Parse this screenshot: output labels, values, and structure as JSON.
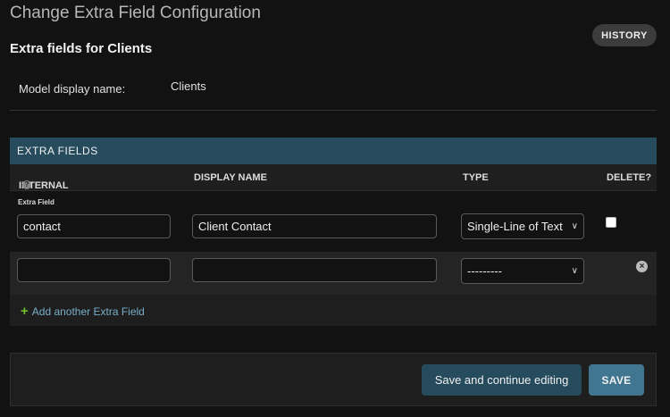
{
  "page": {
    "title": "Change Extra Field Configuration",
    "history_label": "HISTORY",
    "section_title": "Extra fields for Clients"
  },
  "model": {
    "label": "Model display name:",
    "value": "Clients"
  },
  "inline": {
    "header": "EXTRA FIELDS",
    "columns": {
      "internal_name": "INTERNAL NAME",
      "display_name": "DISPLAY NAME",
      "type": "TYPE",
      "delete": "DELETE?"
    },
    "original_label": "Extra Field",
    "rows": [
      {
        "internal_name": "contact",
        "display_name": "Client Contact",
        "type": "Single-Line of Text",
        "delete_checked": false
      },
      {
        "internal_name": "",
        "display_name": "",
        "type": "---------"
      }
    ],
    "add_label": "Add another Extra Field"
  },
  "actions": {
    "save_continue": "Save and continue editing",
    "save": "SAVE"
  },
  "colors": {
    "background": "#121212",
    "inline_header": "#264b5d",
    "save_button": "#417690",
    "link": "#79aec8",
    "add_icon": "#70bf2b"
  }
}
